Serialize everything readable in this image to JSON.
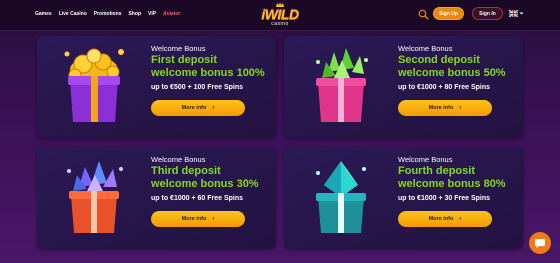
{
  "header": {
    "nav": [
      "Games",
      "Live Casino",
      "Promotions",
      "Shop",
      "VIP",
      "Aviator"
    ],
    "logo_text": "iWILD",
    "logo_sub": "casino",
    "signup_label": "Sign Up",
    "signin_label": "Sign In",
    "colors": {
      "accent": "#f29a05",
      "brand": "#ffc21a"
    }
  },
  "cards": [
    {
      "eyebrow": "Welcome Bonus",
      "title_line1": "First deposit",
      "title_line2": "welcome bonus 100%",
      "offer": "up to €500 + 100 Free Spins",
      "cta": "More info",
      "icon": "purple-gift-gold-coins"
    },
    {
      "eyebrow": "Welcome Bonus",
      "title_line1": "Second deposit",
      "title_line2": "welcome bonus 50%",
      "offer": "up to €1000 + 80 Free Spins",
      "cta": "More info",
      "icon": "pink-gift-green-gems"
    },
    {
      "eyebrow": "Welcome Bonus",
      "title_line1": "Third deposit",
      "title_line2": "welcome bonus 30%",
      "offer": "up to €1000 + 60 Free Spins",
      "cta": "More info",
      "icon": "orange-gift-blue-gems"
    },
    {
      "eyebrow": "Welcome Bonus",
      "title_line1": "Fourth deposit",
      "title_line2": "welcome bonus 80%",
      "offer": "up to €1000 + 30 Free Spins",
      "cta": "More info",
      "icon": "teal-gift-diamond"
    }
  ]
}
